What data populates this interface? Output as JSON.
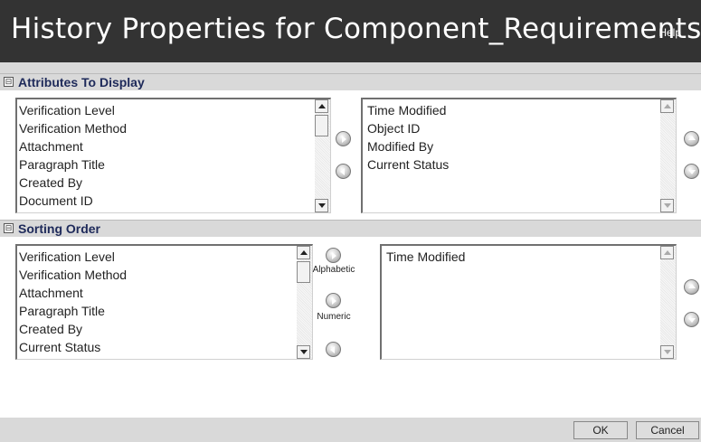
{
  "window": {
    "title": "History Properties for Component_Requirements",
    "help_label": "Help"
  },
  "attributes_section": {
    "toggle": "⊟",
    "label": "Attributes To Display",
    "available": [
      "Verification Level",
      "Verification Method",
      "Attachment",
      "Paragraph Title",
      "Created By",
      "Document ID"
    ],
    "selected": [
      "Time Modified",
      "Object ID",
      "Modified By",
      "Current Status"
    ]
  },
  "sorting_section": {
    "toggle": "⊟",
    "label": "Sorting Order",
    "available": [
      "Verification Level",
      "Verification Method",
      "Attachment",
      "Paragraph Title",
      "Created By",
      "Current Status"
    ],
    "alphabetic_label": "Alphabetic",
    "numeric_label": "Numeric",
    "selected": [
      "Time Modified"
    ]
  },
  "footer": {
    "ok_label": "OK",
    "cancel_label": "Cancel"
  },
  "colors": {
    "titlebar": "#333333",
    "section_label": "#1e2a5a",
    "panel_gray": "#d9d9d9"
  }
}
